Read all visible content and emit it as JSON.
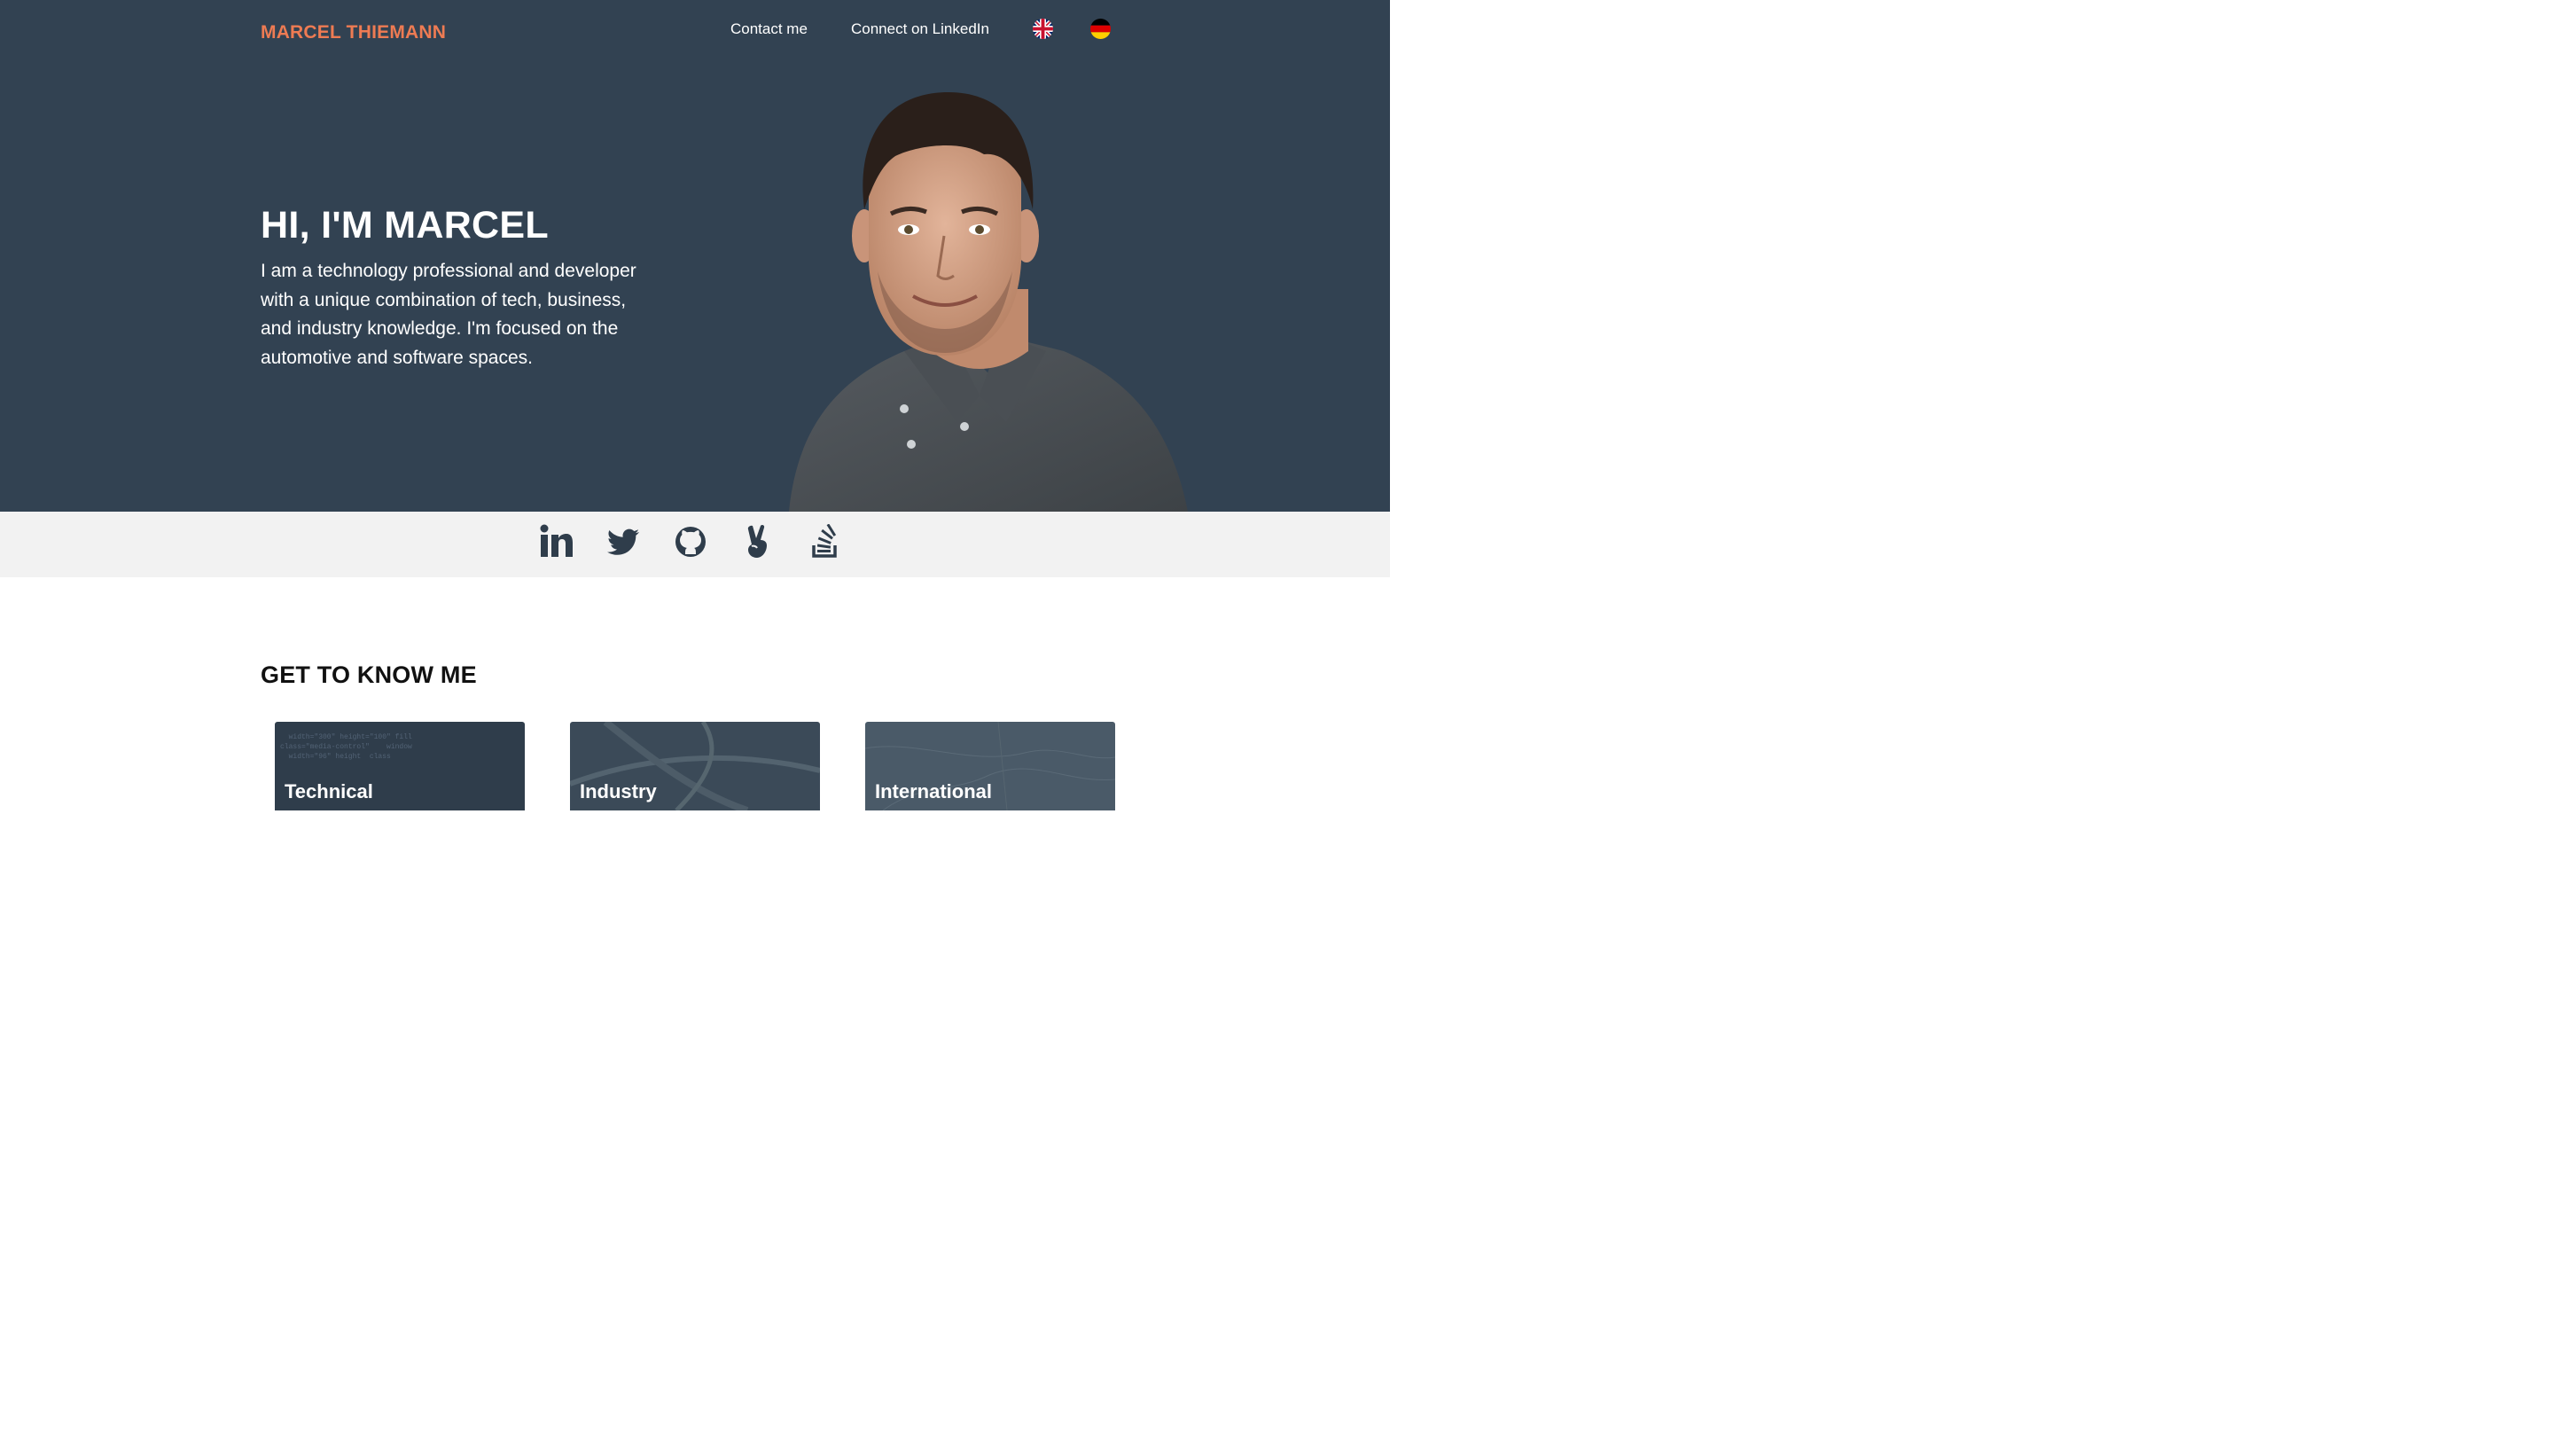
{
  "header": {
    "brand": "MARCEL THIEMANN",
    "nav": {
      "contact": "Contact me",
      "linkedin": "Connect on LinkedIn"
    },
    "languages": [
      {
        "icon": "uk-flag-icon"
      },
      {
        "icon": "germany-flag-icon"
      }
    ]
  },
  "hero": {
    "title": "HI, I'M MARCEL",
    "text": "I am a technology professional and developer with a unique combination of tech, business, and industry knowledge. I'm focused on the automotive and software spaces."
  },
  "social": [
    {
      "icon": "linkedin-icon"
    },
    {
      "icon": "twitter-icon"
    },
    {
      "icon": "github-icon"
    },
    {
      "icon": "angellist-icon"
    },
    {
      "icon": "stackoverflow-icon"
    }
  ],
  "about": {
    "title": "GET TO KNOW ME",
    "cards": [
      {
        "label": "Technical"
      },
      {
        "label": "Industry"
      },
      {
        "label": "International"
      }
    ]
  },
  "colors": {
    "hero_bg": "#324252",
    "brand": "#ee7b53",
    "social_bar_bg": "#f2f2f2",
    "icon": "#2f3d4b"
  }
}
